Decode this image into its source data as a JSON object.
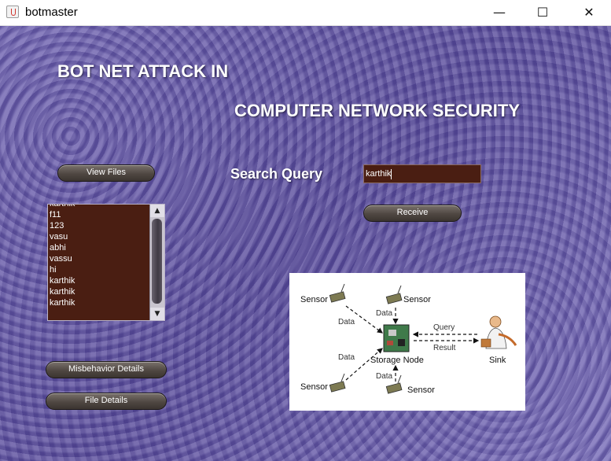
{
  "window": {
    "title": "botmaster",
    "minimize_glyph": "—",
    "maximize_glyph": "☐",
    "close_glyph": "✕"
  },
  "headings": {
    "line1": "BOT NET ATTACK IN",
    "line2": "COMPUTER NETWORK SECURITY"
  },
  "buttons": {
    "view_files": "View Files",
    "receive": "Receive",
    "misbehavior_details": "Misbehavior Details",
    "file_details": "File Details"
  },
  "search": {
    "label": "Search Query",
    "value": "karthik"
  },
  "file_list": {
    "items": [
      "karthik",
      "f11",
      "123",
      "vasu",
      "abhi",
      "vassu",
      "hi",
      "karthik",
      "karthik",
      "karthik"
    ],
    "scroll_up_glyph": "▲",
    "scroll_down_glyph": "▼"
  },
  "diagram": {
    "sensor_top_left": "Sensor",
    "sensor_top_right": "Sensor",
    "sensor_bottom_left": "Sensor",
    "sensor_bottom_right": "Sensor",
    "data_top_left": "Data",
    "data_top": "Data",
    "data_bottom_left": "Data",
    "data_bottom": "Data",
    "storage_node": "Storage Node",
    "query": "Query",
    "result": "Result",
    "sink": "Sink"
  },
  "colors": {
    "background": "#6b5fa8",
    "list_background": "#4a1e12",
    "button_dark": "#4f4742"
  }
}
